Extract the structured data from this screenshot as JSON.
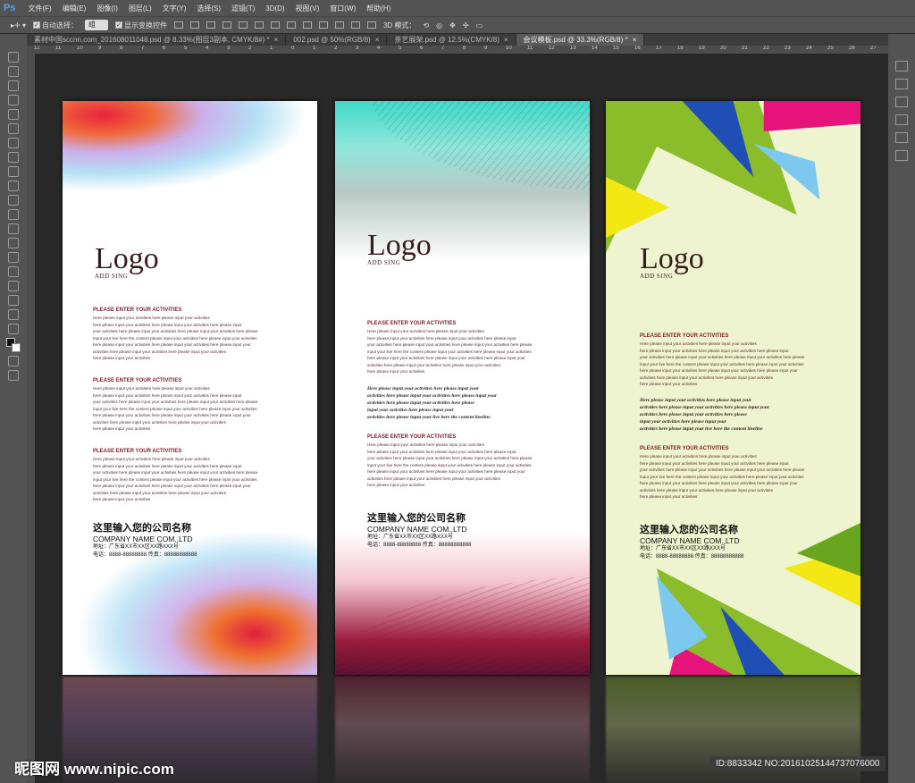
{
  "menubar": {
    "app": "Ps",
    "items": [
      "文件(F)",
      "编辑(E)",
      "图像(I)",
      "图层(L)",
      "文字(Y)",
      "选择(S)",
      "滤镜(T)",
      "3D(D)",
      "视图(V)",
      "窗口(W)",
      "帮助(H)"
    ]
  },
  "options": {
    "auto_select_label": "自动选择：",
    "auto_select_value": "组",
    "show_transform_label": "显示变换控件",
    "mode_3d_label": "3D 模式："
  },
  "tabs": [
    {
      "label": "素材中国sccnn.com_201608011048.psd @ 8.33%(图层3副本, CMYK/8#) *",
      "active": false
    },
    {
      "label": "002.psd @ 50%(RGB/8)",
      "active": false
    },
    {
      "label": "茶艺展架.psd @ 12.5%(CMYK/8)",
      "active": false
    },
    {
      "label": "会议模板.psd @ 33.3%(RGB/8) *",
      "active": true
    }
  ],
  "ruler": [
    "12",
    "11",
    "10",
    "9",
    "8",
    "7",
    "6",
    "5",
    "4",
    "3",
    "2",
    "1",
    "0",
    "1",
    "2",
    "3",
    "4",
    "5",
    "6",
    "7",
    "8",
    "9",
    "10",
    "11",
    "12",
    "13",
    "14",
    "15",
    "16",
    "17",
    "18",
    "19",
    "20",
    "21",
    "22",
    "23",
    "24",
    "25",
    "26",
    "27"
  ],
  "banner": {
    "logo": "Logo",
    "logo_sub": "ADD SING",
    "heading": "PLEASE ENTER YOUR ACTIVITIES",
    "lines": [
      "Here please input your activities here please input your activities",
      "here please input your activities here please input your activities here please input",
      "your activities here please input your activities here please input your activities here please",
      "input your live here the content please input your activities here please input your activities",
      "here please input your activities here please input your activities here please input your",
      "activities here please input your activities here please input your activities",
      "here please input your activities"
    ],
    "script": [
      "Here please input your activities here please input your",
      "activities here please input your activities here please input your",
      "activities here please input your activities here please",
      "input your activities here please input your",
      "activities here please input your live here the content lineline"
    ],
    "company_cn": "这里输入您的公司名称",
    "company_en": "COMPANY NAME COM.,LTD",
    "address": "地址：广东省XX市XX区XX路XXX号",
    "phone": "电话：8888-88888888  传真：88888888888"
  },
  "watermark": {
    "left": "昵图网 www.nipic.com",
    "right": "ID:8833342 NO:20161025144737076000"
  }
}
